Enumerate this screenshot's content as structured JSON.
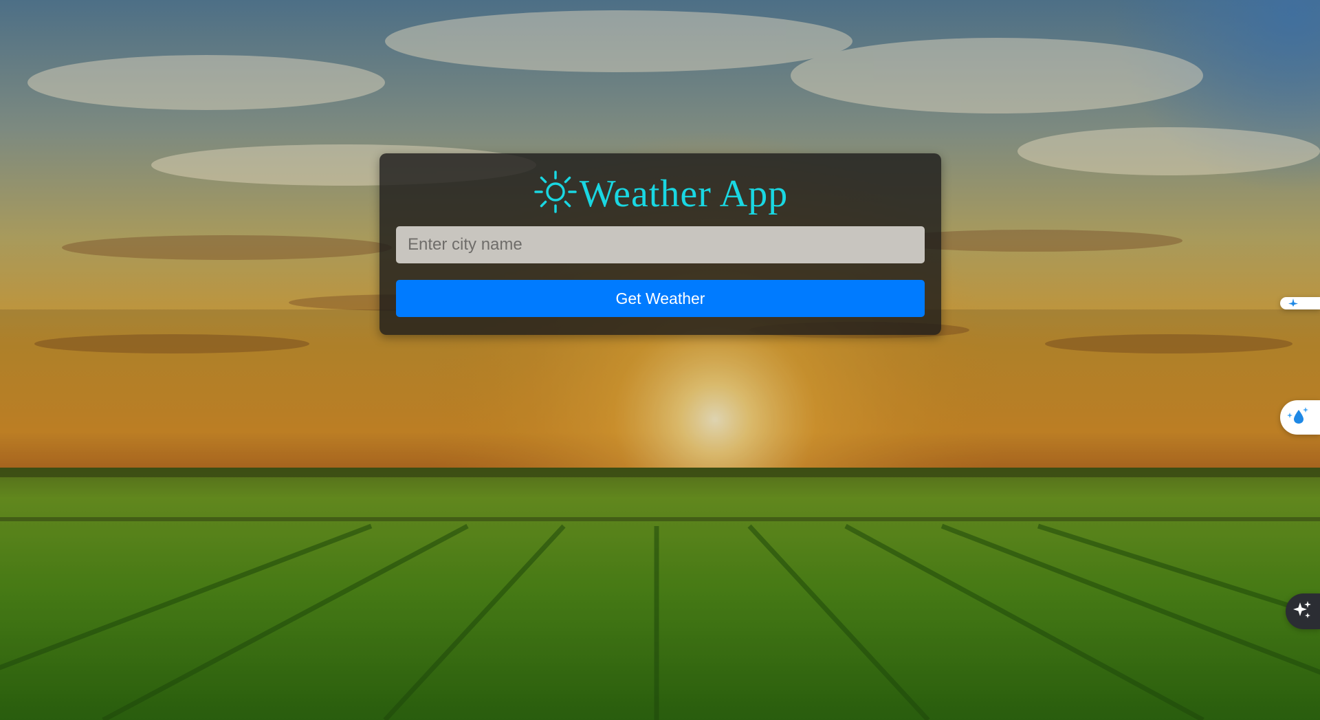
{
  "app": {
    "title": "Weather App",
    "title_icon": "sun-icon",
    "title_color": "#1ad7e2"
  },
  "search": {
    "placeholder": "Enter city name",
    "value": ""
  },
  "actions": {
    "get_weather_label": "Get Weather",
    "button_color": "#007bff"
  },
  "side_widgets": [
    {
      "icon": "sparkle-icon"
    },
    {
      "icon": "water-drop-sparkle-icon"
    },
    {
      "icon": "ai-sparkles-icon"
    }
  ]
}
